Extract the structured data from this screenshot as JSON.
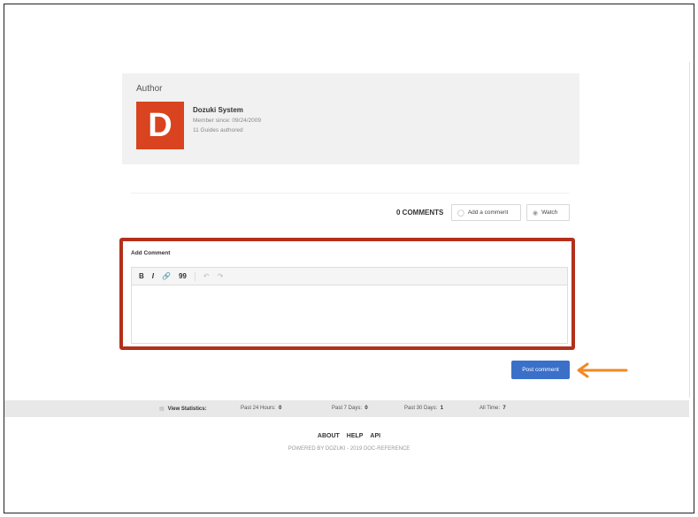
{
  "author_section": {
    "heading": "Author",
    "avatar_letter": "D",
    "avatar_color": "#d9431f",
    "name": "Dozuki System",
    "member_since": "Member since: 09/24/2009",
    "guides_authored": "11 Guides authored"
  },
  "comments": {
    "count_label": "0 COMMENTS",
    "add_button": "Add a comment",
    "watch_button": "Watch",
    "add_comment_label": "Add Comment",
    "toolbar": [
      "B",
      "I",
      "🔗",
      "99",
      "↶",
      "↷"
    ],
    "post_button": "Post comment",
    "highlight_color": "#b2301c",
    "arrow_color": "#f08a24"
  },
  "stats": {
    "label": "View Statistics:",
    "past24_label": "Past 24 Hours:",
    "past24_value": "0",
    "past7_label": "Past 7 Days:",
    "past7_value": "0",
    "past30_label": "Past 30 Days:",
    "past30_value": "1",
    "alltime_label": "All Time:",
    "alltime_value": "7"
  },
  "footer": {
    "about": "ABOUT",
    "help": "HELP",
    "api": "API",
    "powered": "POWERED BY DOZUKI - 2019 DOC-REFERENCE"
  }
}
